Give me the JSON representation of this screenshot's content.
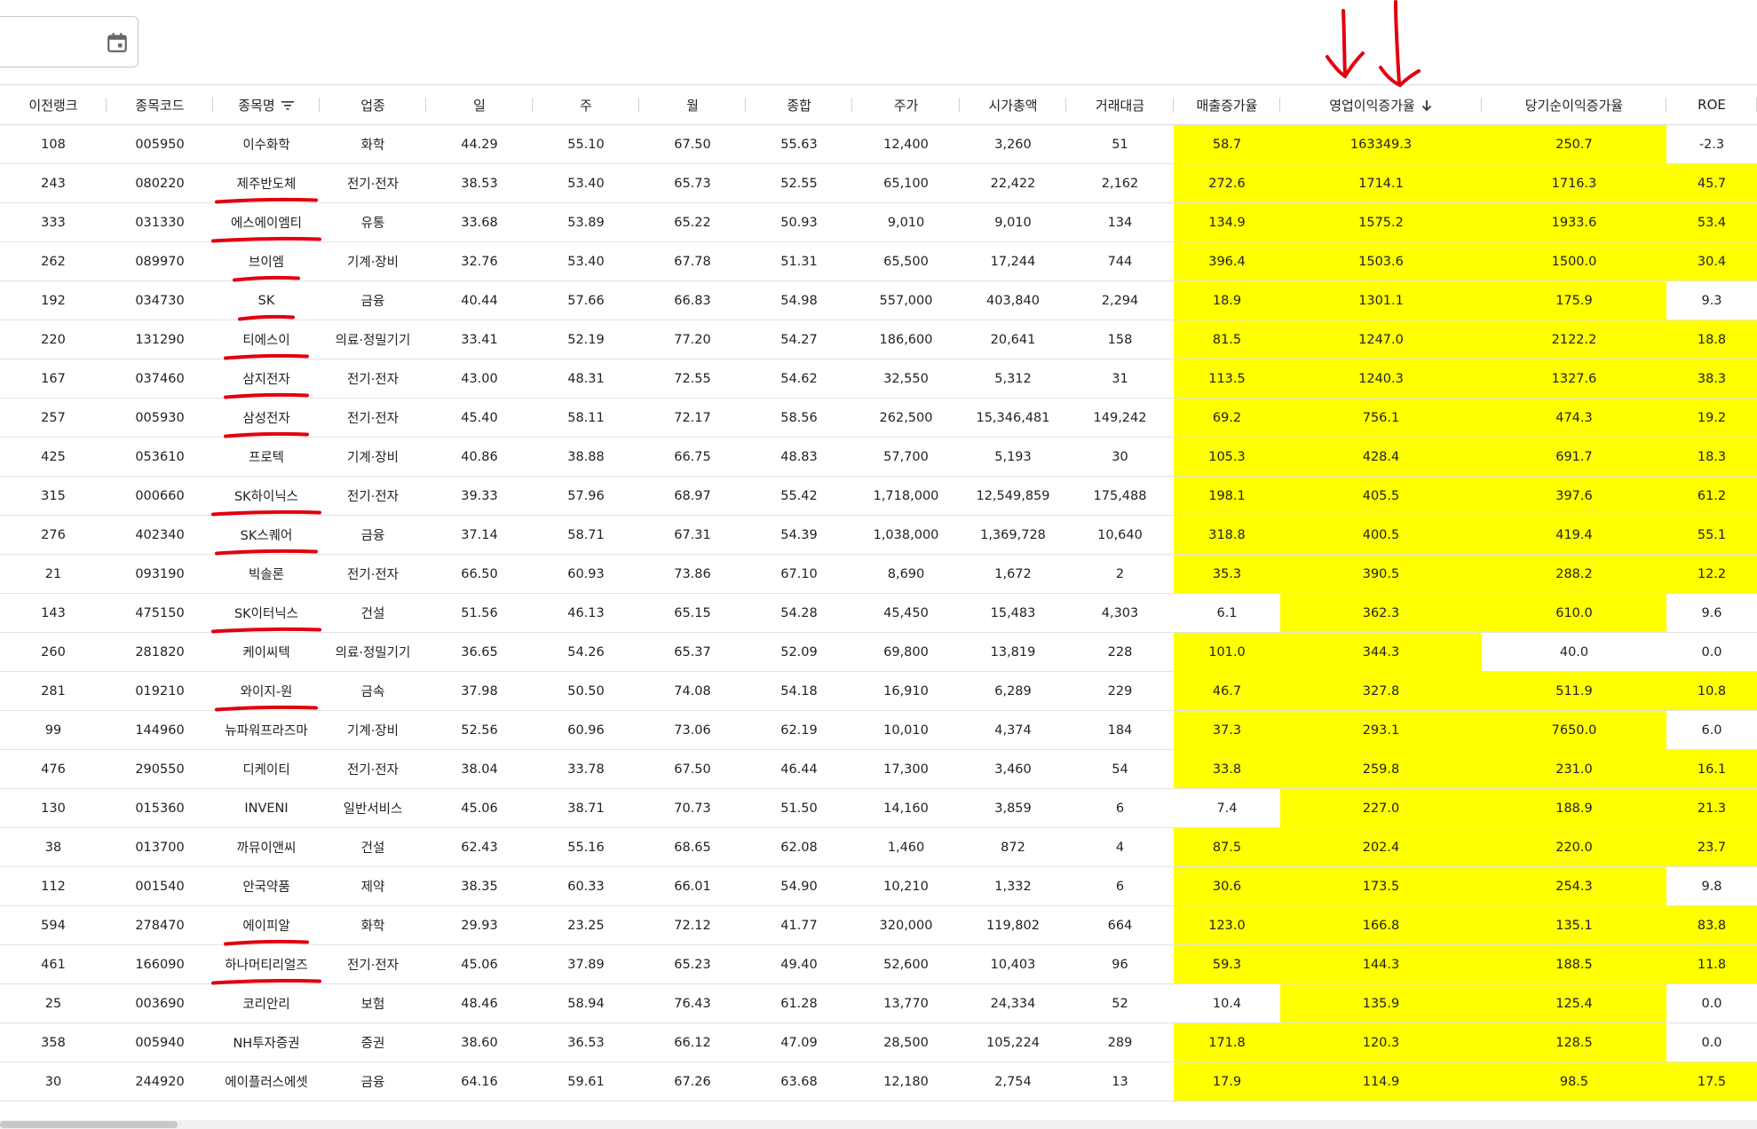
{
  "toolbar": {
    "date_value": "",
    "calendar_icon": "calendar-icon"
  },
  "columns": [
    "이전랭크",
    "종목코드",
    "종목명",
    "업종",
    "일",
    "주",
    "월",
    "종합",
    "주가",
    "시가총액",
    "거래대금",
    "매출증가율",
    "영업이익증가율",
    "당기순이익증가율",
    "ROE"
  ],
  "sort": {
    "filter_column": "종목명",
    "sorted_column": "영업이익증가율",
    "direction": "desc"
  },
  "highlight_color": "#ffff00",
  "annotation_color": "#e0000f",
  "rows": [
    {
      "rank": "108",
      "code": "005950",
      "name": "이수화학",
      "sector": "화학",
      "d": "44.29",
      "w": "55.10",
      "m": "67.50",
      "total": "55.63",
      "price": "12,400",
      "mcap": "3,260",
      "vol": "51",
      "rev": "58.7",
      "op": "163349.3",
      "net": "250.7",
      "roe": "-2.3",
      "hl": [
        1,
        1,
        1,
        0
      ],
      "underlined": false
    },
    {
      "rank": "243",
      "code": "080220",
      "name": "제주반도체",
      "sector": "전기·전자",
      "d": "38.53",
      "w": "53.40",
      "m": "65.73",
      "total": "52.55",
      "price": "65,100",
      "mcap": "22,422",
      "vol": "2,162",
      "rev": "272.6",
      "op": "1714.1",
      "net": "1716.3",
      "roe": "45.7",
      "hl": [
        1,
        1,
        1,
        1
      ],
      "underlined": true
    },
    {
      "rank": "333",
      "code": "031330",
      "name": "에스에이엠티",
      "sector": "유통",
      "d": "33.68",
      "w": "53.89",
      "m": "65.22",
      "total": "50.93",
      "price": "9,010",
      "mcap": "9,010",
      "vol": "134",
      "rev": "134.9",
      "op": "1575.2",
      "net": "1933.6",
      "roe": "53.4",
      "hl": [
        1,
        1,
        1,
        1
      ],
      "underlined": true
    },
    {
      "rank": "262",
      "code": "089970",
      "name": "브이엠",
      "sector": "기계·장비",
      "d": "32.76",
      "w": "53.40",
      "m": "67.78",
      "total": "51.31",
      "price": "65,500",
      "mcap": "17,244",
      "vol": "744",
      "rev": "396.4",
      "op": "1503.6",
      "net": "1500.0",
      "roe": "30.4",
      "hl": [
        1,
        1,
        1,
        1
      ],
      "underlined": true
    },
    {
      "rank": "192",
      "code": "034730",
      "name": "SK",
      "sector": "금융",
      "d": "40.44",
      "w": "57.66",
      "m": "66.83",
      "total": "54.98",
      "price": "557,000",
      "mcap": "403,840",
      "vol": "2,294",
      "rev": "18.9",
      "op": "1301.1",
      "net": "175.9",
      "roe": "9.3",
      "hl": [
        1,
        1,
        1,
        0
      ],
      "underlined": true
    },
    {
      "rank": "220",
      "code": "131290",
      "name": "티에스이",
      "sector": "의료·정밀기기",
      "d": "33.41",
      "w": "52.19",
      "m": "77.20",
      "total": "54.27",
      "price": "186,600",
      "mcap": "20,641",
      "vol": "158",
      "rev": "81.5",
      "op": "1247.0",
      "net": "2122.2",
      "roe": "18.8",
      "hl": [
        1,
        1,
        1,
        1
      ],
      "underlined": true
    },
    {
      "rank": "167",
      "code": "037460",
      "name": "삼지전자",
      "sector": "전기·전자",
      "d": "43.00",
      "w": "48.31",
      "m": "72.55",
      "total": "54.62",
      "price": "32,550",
      "mcap": "5,312",
      "vol": "31",
      "rev": "113.5",
      "op": "1240.3",
      "net": "1327.6",
      "roe": "38.3",
      "hl": [
        1,
        1,
        1,
        1
      ],
      "underlined": true
    },
    {
      "rank": "257",
      "code": "005930",
      "name": "삼성전자",
      "sector": "전기·전자",
      "d": "45.40",
      "w": "58.11",
      "m": "72.17",
      "total": "58.56",
      "price": "262,500",
      "mcap": "15,346,481",
      "vol": "149,242",
      "rev": "69.2",
      "op": "756.1",
      "net": "474.3",
      "roe": "19.2",
      "hl": [
        1,
        1,
        1,
        1
      ],
      "underlined": true
    },
    {
      "rank": "425",
      "code": "053610",
      "name": "프로텍",
      "sector": "기계·장비",
      "d": "40.86",
      "w": "38.88",
      "m": "66.75",
      "total": "48.83",
      "price": "57,700",
      "mcap": "5,193",
      "vol": "30",
      "rev": "105.3",
      "op": "428.4",
      "net": "691.7",
      "roe": "18.3",
      "hl": [
        1,
        1,
        1,
        1
      ],
      "underlined": false
    },
    {
      "rank": "315",
      "code": "000660",
      "name": "SK하이닉스",
      "sector": "전기·전자",
      "d": "39.33",
      "w": "57.96",
      "m": "68.97",
      "total": "55.42",
      "price": "1,718,000",
      "mcap": "12,549,859",
      "vol": "175,488",
      "rev": "198.1",
      "op": "405.5",
      "net": "397.6",
      "roe": "61.2",
      "hl": [
        1,
        1,
        1,
        1
      ],
      "underlined": true
    },
    {
      "rank": "276",
      "code": "402340",
      "name": "SK스퀘어",
      "sector": "금융",
      "d": "37.14",
      "w": "58.71",
      "m": "67.31",
      "total": "54.39",
      "price": "1,038,000",
      "mcap": "1,369,728",
      "vol": "10,640",
      "rev": "318.8",
      "op": "400.5",
      "net": "419.4",
      "roe": "55.1",
      "hl": [
        1,
        1,
        1,
        1
      ],
      "underlined": true
    },
    {
      "rank": "21",
      "code": "093190",
      "name": "빅솔론",
      "sector": "전기·전자",
      "d": "66.50",
      "w": "60.93",
      "m": "73.86",
      "total": "67.10",
      "price": "8,690",
      "mcap": "1,672",
      "vol": "2",
      "rev": "35.3",
      "op": "390.5",
      "net": "288.2",
      "roe": "12.2",
      "hl": [
        1,
        1,
        1,
        1
      ],
      "underlined": false
    },
    {
      "rank": "143",
      "code": "475150",
      "name": "SK이터닉스",
      "sector": "건설",
      "d": "51.56",
      "w": "46.13",
      "m": "65.15",
      "total": "54.28",
      "price": "45,450",
      "mcap": "15,483",
      "vol": "4,303",
      "rev": "6.1",
      "op": "362.3",
      "net": "610.0",
      "roe": "9.6",
      "hl": [
        0,
        1,
        1,
        0
      ],
      "underlined": true
    },
    {
      "rank": "260",
      "code": "281820",
      "name": "케이씨텍",
      "sector": "의료·정밀기기",
      "d": "36.65",
      "w": "54.26",
      "m": "65.37",
      "total": "52.09",
      "price": "69,800",
      "mcap": "13,819",
      "vol": "228",
      "rev": "101.0",
      "op": "344.3",
      "net": "40.0",
      "roe": "0.0",
      "hl": [
        1,
        1,
        0,
        0
      ],
      "underlined": false
    },
    {
      "rank": "281",
      "code": "019210",
      "name": "와이지-원",
      "sector": "금속",
      "d": "37.98",
      "w": "50.50",
      "m": "74.08",
      "total": "54.18",
      "price": "16,910",
      "mcap": "6,289",
      "vol": "229",
      "rev": "46.7",
      "op": "327.8",
      "net": "511.9",
      "roe": "10.8",
      "hl": [
        1,
        1,
        1,
        1
      ],
      "underlined": true
    },
    {
      "rank": "99",
      "code": "144960",
      "name": "뉴파워프라즈마",
      "sector": "기계·장비",
      "d": "52.56",
      "w": "60.96",
      "m": "73.06",
      "total": "62.19",
      "price": "10,010",
      "mcap": "4,374",
      "vol": "184",
      "rev": "37.3",
      "op": "293.1",
      "net": "7650.0",
      "roe": "6.0",
      "hl": [
        1,
        1,
        1,
        0
      ],
      "underlined": false
    },
    {
      "rank": "476",
      "code": "290550",
      "name": "디케이티",
      "sector": "전기·전자",
      "d": "38.04",
      "w": "33.78",
      "m": "67.50",
      "total": "46.44",
      "price": "17,300",
      "mcap": "3,460",
      "vol": "54",
      "rev": "33.8",
      "op": "259.8",
      "net": "231.0",
      "roe": "16.1",
      "hl": [
        1,
        1,
        1,
        1
      ],
      "underlined": false
    },
    {
      "rank": "130",
      "code": "015360",
      "name": "INVENI",
      "sector": "일반서비스",
      "d": "45.06",
      "w": "38.71",
      "m": "70.73",
      "total": "51.50",
      "price": "14,160",
      "mcap": "3,859",
      "vol": "6",
      "rev": "7.4",
      "op": "227.0",
      "net": "188.9",
      "roe": "21.3",
      "hl": [
        0,
        1,
        1,
        1
      ],
      "underlined": false
    },
    {
      "rank": "38",
      "code": "013700",
      "name": "까뮤이앤씨",
      "sector": "건설",
      "d": "62.43",
      "w": "55.16",
      "m": "68.65",
      "total": "62.08",
      "price": "1,460",
      "mcap": "872",
      "vol": "4",
      "rev": "87.5",
      "op": "202.4",
      "net": "220.0",
      "roe": "23.7",
      "hl": [
        1,
        1,
        1,
        1
      ],
      "underlined": false
    },
    {
      "rank": "112",
      "code": "001540",
      "name": "안국약품",
      "sector": "제약",
      "d": "38.35",
      "w": "60.33",
      "m": "66.01",
      "total": "54.90",
      "price": "10,210",
      "mcap": "1,332",
      "vol": "6",
      "rev": "30.6",
      "op": "173.5",
      "net": "254.3",
      "roe": "9.8",
      "hl": [
        1,
        1,
        1,
        0
      ],
      "underlined": false
    },
    {
      "rank": "594",
      "code": "278470",
      "name": "에이피알",
      "sector": "화학",
      "d": "29.93",
      "w": "23.25",
      "m": "72.12",
      "total": "41.77",
      "price": "320,000",
      "mcap": "119,802",
      "vol": "664",
      "rev": "123.0",
      "op": "166.8",
      "net": "135.1",
      "roe": "83.8",
      "hl": [
        1,
        1,
        1,
        1
      ],
      "underlined": true
    },
    {
      "rank": "461",
      "code": "166090",
      "name": "하나머티리얼즈",
      "sector": "전기·전자",
      "d": "45.06",
      "w": "37.89",
      "m": "65.23",
      "total": "49.40",
      "price": "52,600",
      "mcap": "10,403",
      "vol": "96",
      "rev": "59.3",
      "op": "144.3",
      "net": "188.5",
      "roe": "11.8",
      "hl": [
        1,
        1,
        1,
        1
      ],
      "underlined": true
    },
    {
      "rank": "25",
      "code": "003690",
      "name": "코리안리",
      "sector": "보험",
      "d": "48.46",
      "w": "58.94",
      "m": "76.43",
      "total": "61.28",
      "price": "13,770",
      "mcap": "24,334",
      "vol": "52",
      "rev": "10.4",
      "op": "135.9",
      "net": "125.4",
      "roe": "0.0",
      "hl": [
        0,
        1,
        1,
        0
      ],
      "underlined": false
    },
    {
      "rank": "358",
      "code": "005940",
      "name": "NH투자증권",
      "sector": "증권",
      "d": "38.60",
      "w": "36.53",
      "m": "66.12",
      "total": "47.09",
      "price": "28,500",
      "mcap": "105,224",
      "vol": "289",
      "rev": "171.8",
      "op": "120.3",
      "net": "128.5",
      "roe": "0.0",
      "hl": [
        1,
        1,
        1,
        0
      ],
      "underlined": false
    },
    {
      "rank": "30",
      "code": "244920",
      "name": "에이플러스에셋",
      "sector": "금융",
      "d": "64.16",
      "w": "59.61",
      "m": "67.26",
      "total": "63.68",
      "price": "12,180",
      "mcap": "2,754",
      "vol": "13",
      "rev": "17.9",
      "op": "114.9",
      "net": "98.5",
      "roe": "17.5",
      "hl": [
        1,
        1,
        1,
        1
      ],
      "underlined": false
    }
  ]
}
